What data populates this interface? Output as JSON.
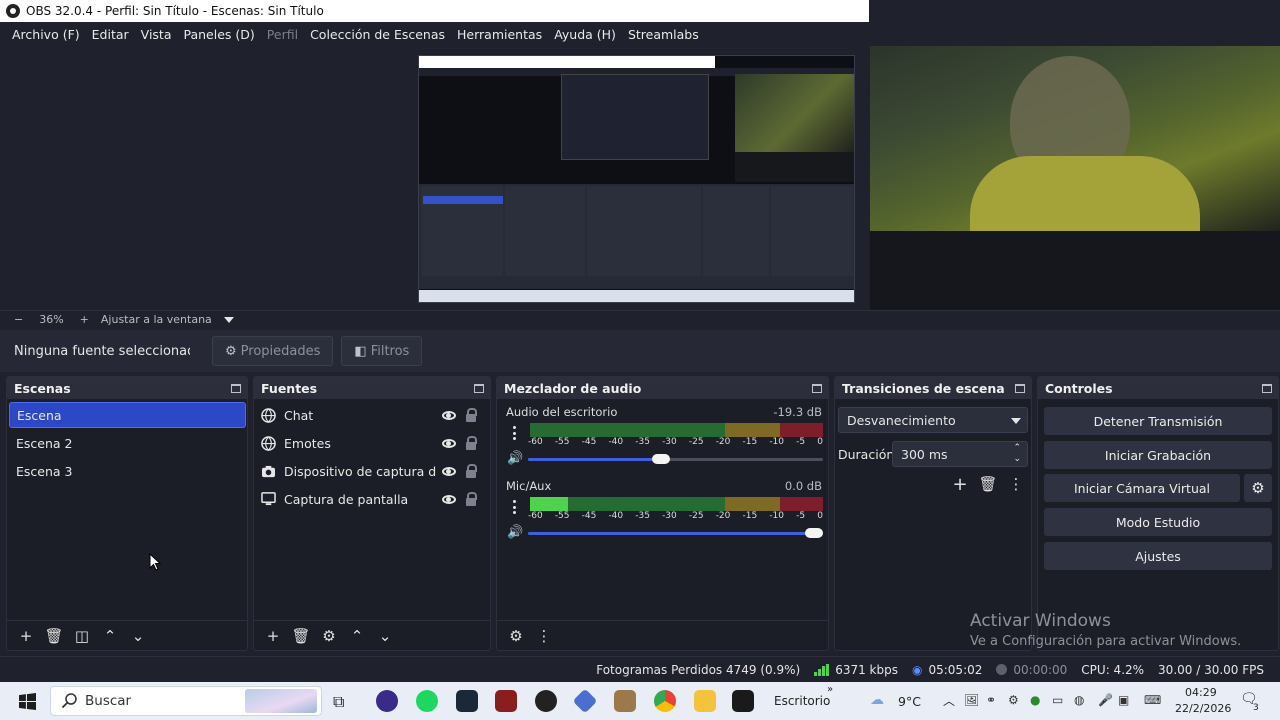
{
  "window": {
    "title": "OBS 32.0.4 - Perfil: Sin Título - Escenas: Sin Título"
  },
  "menu": [
    {
      "label": "Archivo (F)",
      "disabled": false
    },
    {
      "label": "Editar",
      "disabled": false
    },
    {
      "label": "Vista",
      "disabled": false
    },
    {
      "label": "Paneles (D)",
      "disabled": false
    },
    {
      "label": "Perfil",
      "disabled": true
    },
    {
      "label": "Colección de Escenas",
      "disabled": false
    },
    {
      "label": "Herramientas",
      "disabled": false
    },
    {
      "label": "Ayuda (H)",
      "disabled": false
    },
    {
      "label": "Streamlabs",
      "disabled": false
    }
  ],
  "zoom": {
    "minus": "−",
    "level": "36%",
    "plus": "+",
    "fit_label": "Ajustar a la ventana"
  },
  "source_toolbar": {
    "no_source": "Ninguna fuente seleccionada",
    "properties": "Propiedades",
    "filters": "Filtros"
  },
  "scenes": {
    "title": "Escenas",
    "items": [
      "Escena",
      "Escena 2",
      "Escena 3"
    ],
    "selected": "Escena"
  },
  "sources": {
    "title": "Fuentes",
    "items": [
      {
        "name": "Chat",
        "icon": "globe-icon"
      },
      {
        "name": "Emotes",
        "icon": "globe-icon"
      },
      {
        "name": "Dispositivo de captura de video",
        "icon": "camera-icon"
      },
      {
        "name": "Captura de pantalla",
        "icon": "monitor-icon"
      }
    ]
  },
  "mixer": {
    "title": "Mezclador de audio",
    "ticks": [
      "-60",
      "-55",
      "-45",
      "-40",
      "-35",
      "-30",
      "-25",
      "-20",
      "-15",
      "-10",
      "-5",
      "0"
    ],
    "channels": [
      {
        "name": "Audio del escritorio",
        "db": "-19.3 dB",
        "level_pct": 0,
        "volume_pct": 48
      },
      {
        "name": "Mic/Aux",
        "db": "0.0 dB",
        "level_pct": 13,
        "volume_pct": 100
      }
    ]
  },
  "transitions": {
    "title": "Transiciones de escena",
    "selected": "Desvanecimiento",
    "duration_label": "Duración",
    "duration_value": "300 ms"
  },
  "controls": {
    "title": "Controles",
    "stop_stream": "Detener Transmisión",
    "start_recording": "Iniciar Grabación",
    "start_virtual_cam": "Iniciar Cámara Virtual",
    "studio_mode": "Modo Estudio",
    "settings": "Ajustes"
  },
  "watermark": {
    "line1": "Activar Windows",
    "line2": "Ve a Configuración para activar Windows."
  },
  "status": {
    "dropped_frames": "Fotogramas Perdidos 4749 (0.9%)",
    "bitrate": "6371 kbps",
    "stream_time": "05:05:02",
    "rec_time": "00:00:00",
    "cpu": "CPU: 4.2%",
    "fps": "30.00 / 30.00 FPS"
  },
  "taskbar": {
    "search_placeholder": "Buscar",
    "desktop_label": "Escritorio",
    "weather": "9°C",
    "time": "04:29",
    "date": "22/2/2026",
    "notifications": "3"
  },
  "colors": {
    "accent": "#2c48c6",
    "background": "#1f212c",
    "dock": "#1c1e27"
  }
}
